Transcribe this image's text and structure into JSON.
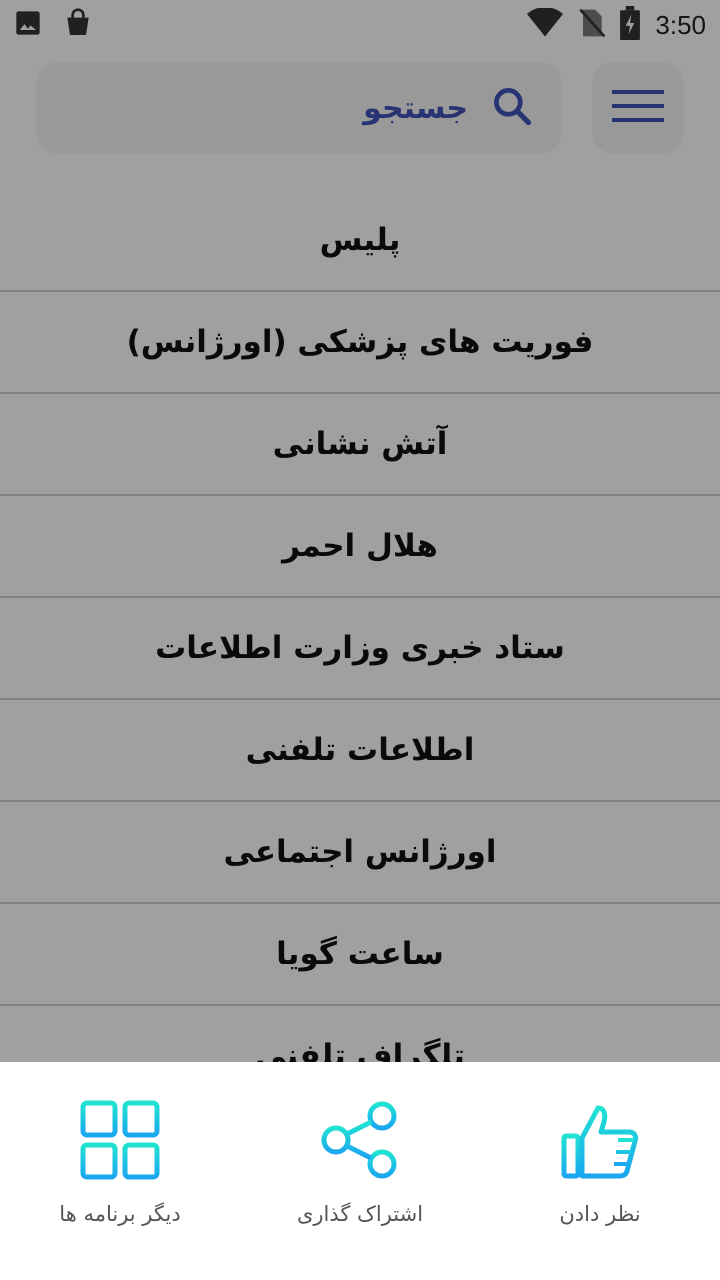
{
  "status_bar": {
    "time": "3:50",
    "left_icons": [
      "image-icon",
      "shopping-bag-icon"
    ],
    "right_icons": [
      "wifi-icon",
      "no-sim-icon",
      "battery-charging-icon"
    ]
  },
  "toolbar": {
    "search_label": "جستجو",
    "menu_icon": "hamburger-menu-icon",
    "search_icon": "search-icon",
    "accent_color": "#3f51b5"
  },
  "list": {
    "items": [
      {
        "label": "پلیس"
      },
      {
        "label": "فوریت های پزشکی (اورژانس)"
      },
      {
        "label": "آتش نشانی"
      },
      {
        "label": "هلال احمر"
      },
      {
        "label": "ستاد خبری وزارت اطلاعات"
      },
      {
        "label": "اطلاعات تلفنی"
      },
      {
        "label": "اورژانس اجتماعی"
      },
      {
        "label": "ساعت گویا"
      },
      {
        "label": "تلگراف تلفنی"
      }
    ]
  },
  "bottom_sheet": {
    "actions": [
      {
        "label": "دیگر برنامه ها",
        "icon": "grid-icon"
      },
      {
        "label": "اشتراک گذاری",
        "icon": "share-icon"
      },
      {
        "label": "نظر دادن",
        "icon": "thumbs-up-icon"
      }
    ],
    "icon_gradient": [
      "#20e3d2",
      "#1aa7f0"
    ]
  }
}
